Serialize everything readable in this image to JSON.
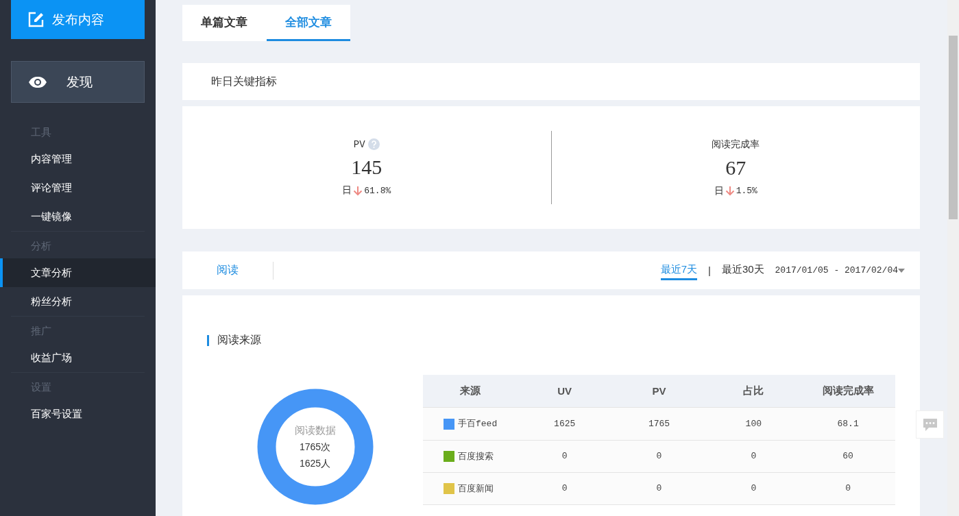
{
  "sidebar": {
    "publish_button": "发布内容",
    "discover_button": "发现",
    "sections": [
      {
        "heading": "工具",
        "items": [
          {
            "label": "内容管理",
            "selected": false
          },
          {
            "label": "评论管理",
            "selected": false
          },
          {
            "label": "一键镜像",
            "selected": false
          }
        ]
      },
      {
        "heading": "分析",
        "items": [
          {
            "label": "文章分析",
            "selected": true
          },
          {
            "label": "粉丝分析",
            "selected": false
          }
        ]
      },
      {
        "heading": "推广",
        "items": [
          {
            "label": "收益广场",
            "selected": false
          }
        ]
      },
      {
        "heading": "设置",
        "items": [
          {
            "label": "百家号设置",
            "selected": false
          }
        ]
      }
    ]
  },
  "article_tabs": [
    {
      "label": "单篇文章",
      "selected": false
    },
    {
      "label": "全部文章",
      "selected": true
    }
  ],
  "key_metrics": {
    "title": "昨日关键指标",
    "metrics": [
      {
        "name": "PV",
        "help": true,
        "value": "145",
        "period": "日",
        "down": true,
        "change": "61.8%"
      },
      {
        "name": "阅读完成率",
        "value": "67",
        "period": "日",
        "down": true,
        "change": "1.5%"
      }
    ]
  },
  "metric_tabs": [
    {
      "label": "阅读",
      "selected": true
    }
  ],
  "range_tabs": [
    {
      "label": "最近7天",
      "selected": true
    },
    {
      "label": "最近30天",
      "selected": false
    }
  ],
  "range_separator": "|",
  "date_range": "2017/01/05 - 2017/02/04",
  "source_section": {
    "title": "阅读来源",
    "donut": {
      "label": "阅读数据",
      "count": "1765次",
      "people": "1625人"
    },
    "table": {
      "columns": [
        "来源",
        "UV",
        "PV",
        "占比",
        "阅读完成率"
      ],
      "rows": [
        {
          "color": "#4696f6",
          "cells": [
            "手百feed",
            "1625",
            "1765",
            "100",
            "68.1"
          ]
        },
        {
          "color": "#6aad1b",
          "cells": [
            "百度搜索",
            "0",
            "0",
            "0",
            "60"
          ]
        },
        {
          "color": "#e0c449",
          "cells": [
            "百度新闻",
            "0",
            "0",
            "0",
            "0"
          ]
        }
      ]
    }
  }
}
